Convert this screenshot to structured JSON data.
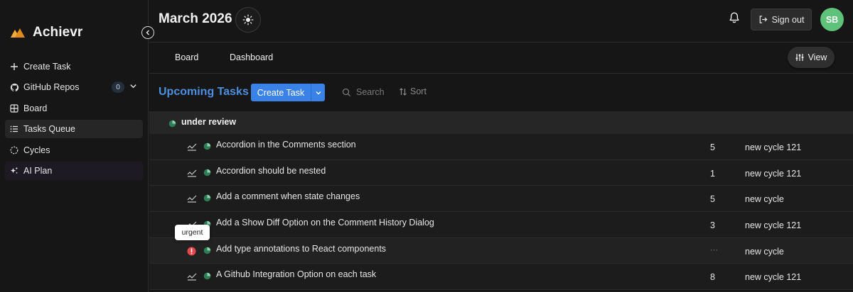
{
  "app": {
    "name": "Achievr"
  },
  "sidebar": {
    "items": [
      {
        "label": "Create Task",
        "icon": "plus-icon"
      },
      {
        "label": "GitHub Repos",
        "icon": "github-icon",
        "count": "0"
      },
      {
        "label": "Board",
        "icon": "board-grid-icon"
      },
      {
        "label": "Tasks Queue",
        "icon": "list-icon"
      },
      {
        "label": "Cycles",
        "icon": "cycle-icon"
      },
      {
        "label": "AI Plan",
        "icon": "sparkles-icon"
      }
    ]
  },
  "header": {
    "title": "March 2026",
    "sign_out_label": "Sign out",
    "avatar_initials": "SB"
  },
  "tabs": [
    {
      "label": "Board"
    },
    {
      "label": "Dashboard"
    }
  ],
  "view_button_label": "View",
  "toolbar": {
    "section_title": "Upcoming Tasks",
    "create_label": "Create Task",
    "search_placeholder": "Search",
    "sort_label": "Sort"
  },
  "group": {
    "label": "under review"
  },
  "tasks": [
    {
      "title": "Accordion in the Comments section",
      "points": "5",
      "cycle": "new cycle 121",
      "priority": "none"
    },
    {
      "title": "Accordion should be nested",
      "points": "1",
      "cycle": "new cycle 121",
      "priority": "none"
    },
    {
      "title": "Add a comment when state changes",
      "points": "5",
      "cycle": "new cycle",
      "priority": "none"
    },
    {
      "title": "Add a Show Diff Option on the Comment History Dialog",
      "points": "3",
      "cycle": "new cycle 121",
      "priority": "none"
    },
    {
      "title": "Add type annotations to React components",
      "points": "···",
      "cycle": "new cycle",
      "priority": "urgent"
    },
    {
      "title": "A Github Integration Option on each task",
      "points": "8",
      "cycle": "new cycle 121",
      "priority": "none"
    }
  ],
  "tooltip": {
    "text": "urgent"
  },
  "colors": {
    "accent": "#3b82e8",
    "section_title": "#4d8fe0",
    "avatar": "#5fc27a",
    "urgent": "#e5484d",
    "state_review": "#3aa66b"
  }
}
